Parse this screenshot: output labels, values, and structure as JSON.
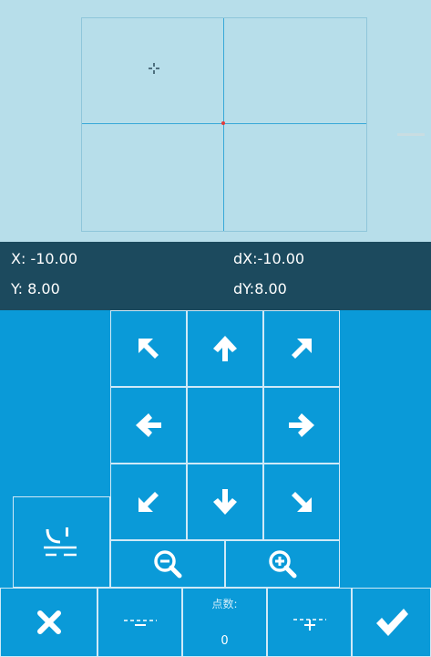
{
  "coords": {
    "x": "X: -10.00",
    "y": "Y: 8.00",
    "dx": "dX:-10.00",
    "dy": "dY:8.00"
  },
  "points": {
    "label": "点数:",
    "value": "0"
  },
  "icons": {
    "up_left": "arrow-up-left-icon",
    "up": "arrow-up-icon",
    "up_right": "arrow-up-right-icon",
    "left": "arrow-left-icon",
    "right": "arrow-right-icon",
    "down_left": "arrow-down-left-icon",
    "down": "arrow-down-icon",
    "down_right": "arrow-down-right-icon",
    "zoom_out": "zoom-out-icon",
    "zoom_in": "zoom-in-icon",
    "presser_foot": "presser-foot-icon",
    "cancel": "close-icon",
    "delete_point": "delete-point-icon",
    "add_point": "add-point-icon",
    "confirm": "checkmark-icon"
  },
  "colors": {
    "panel": "#0a9ad8",
    "preview_bg": "#b7deea",
    "coord_bar": "#1c4a5e",
    "crosshair": "#38a8d8",
    "origin": "#e23b3b"
  }
}
